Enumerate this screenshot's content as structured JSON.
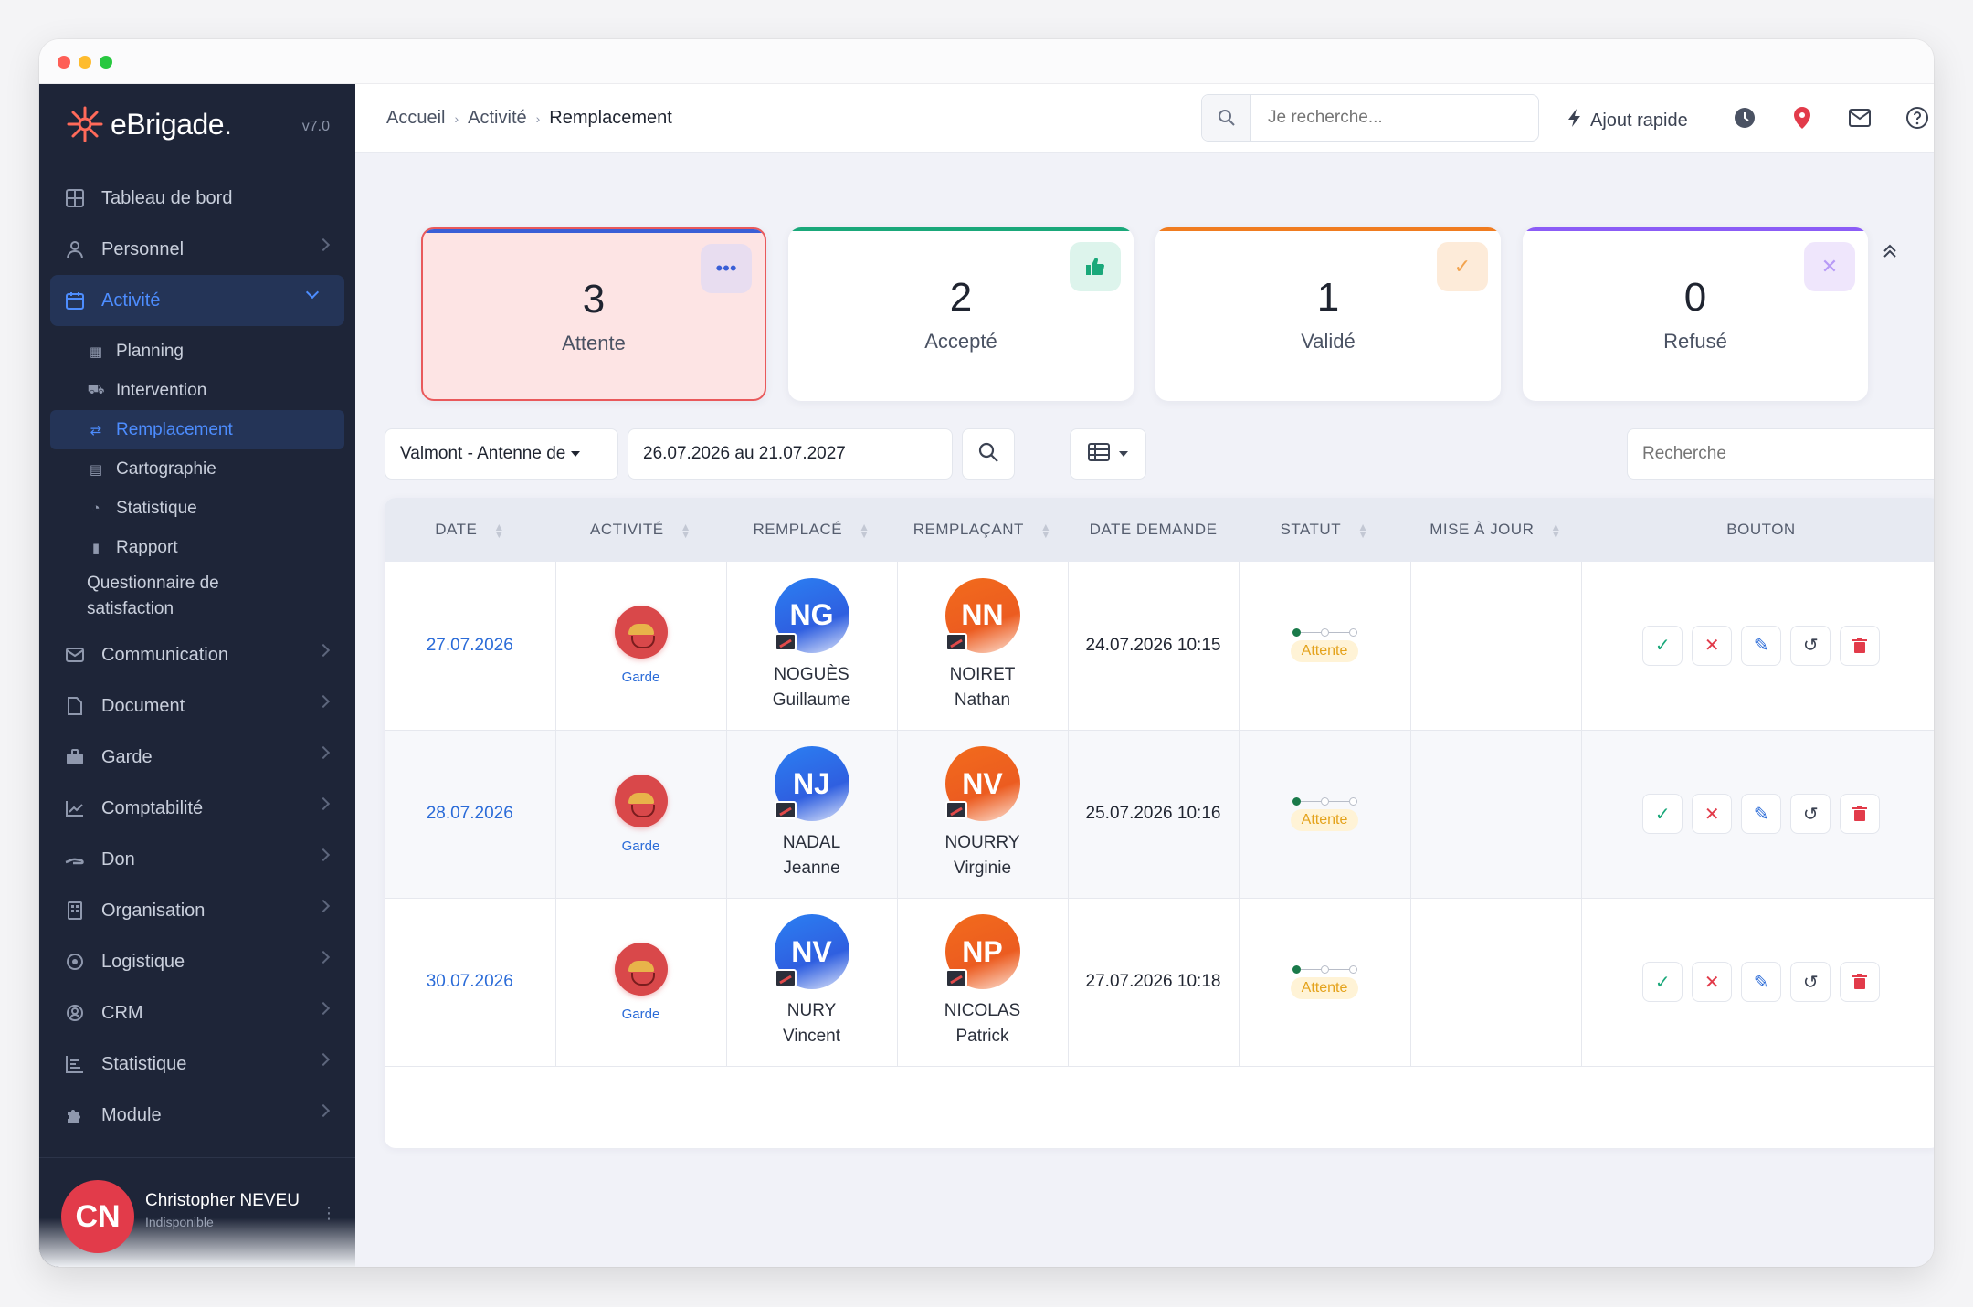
{
  "app": {
    "brand": "eBrigade.",
    "version": "v7.0"
  },
  "sidebar": {
    "items": [
      {
        "label": "Tableau de bord",
        "icon": "dashboard-icon"
      },
      {
        "label": "Personnel",
        "icon": "user-icon"
      },
      {
        "label": "Activité",
        "icon": "calendar-icon"
      },
      {
        "label": "Communication",
        "icon": "mail-icon"
      },
      {
        "label": "Document",
        "icon": "file-icon"
      },
      {
        "label": "Garde",
        "icon": "briefcase-icon"
      },
      {
        "label": "Comptabilité",
        "icon": "chart-icon"
      },
      {
        "label": "Don",
        "icon": "hand-icon"
      },
      {
        "label": "Organisation",
        "icon": "building-icon"
      },
      {
        "label": "Logistique",
        "icon": "target-icon"
      },
      {
        "label": "CRM",
        "icon": "user-circle-icon"
      },
      {
        "label": "Statistique",
        "icon": "stats-icon"
      },
      {
        "label": "Module",
        "icon": "puzzle-icon"
      }
    ],
    "sub_items": [
      {
        "label": "Planning",
        "icon": "calendar-small-icon"
      },
      {
        "label": "Intervention",
        "icon": "truck-icon"
      },
      {
        "label": "Remplacement",
        "icon": "swap-icon"
      },
      {
        "label": "Cartographie",
        "icon": "map-icon"
      },
      {
        "label": "Statistique",
        "icon": "pie-icon"
      },
      {
        "label": "Rapport",
        "icon": "report-icon"
      },
      {
        "label": "Questionnaire de satisfaction",
        "icon": ""
      }
    ],
    "user": {
      "initials": "CN",
      "name": "Christopher NEVEU",
      "status": "Indisponible"
    }
  },
  "topbar": {
    "breadcrumb": [
      "Accueil",
      "Activité",
      "Remplacement"
    ],
    "search_placeholder": "Je recherche...",
    "quick_add": "Ajout rapide"
  },
  "cards": [
    {
      "count": "3",
      "label": "Attente"
    },
    {
      "count": "2",
      "label": "Accepté"
    },
    {
      "count": "1",
      "label": "Validé"
    },
    {
      "count": "0",
      "label": "Refusé"
    }
  ],
  "filters": {
    "section": "Valmont - Antenne de",
    "date_range": "26.07.2026 au 21.07.2027",
    "search_placeholder": "Recherche"
  },
  "table": {
    "headers": [
      "DATE",
      "ACTIVITÉ",
      "REMPLACÉ",
      "REMPLAÇANT",
      "DATE DEMANDE",
      "STATUT",
      "MISE À JOUR",
      "BOUTON"
    ],
    "rows": [
      {
        "date": "27.07.2026",
        "activity": "Garde",
        "replaced": {
          "initials": "NG",
          "last": "NOGUÈS",
          "first": "Guillaume"
        },
        "replacement": {
          "initials": "NN",
          "last": "NOIRET",
          "first": "Nathan"
        },
        "requested": "24.07.2026 10:15",
        "status": "Attente"
      },
      {
        "date": "28.07.2026",
        "activity": "Garde",
        "replaced": {
          "initials": "NJ",
          "last": "NADAL",
          "first": "Jeanne"
        },
        "replacement": {
          "initials": "NV",
          "last": "NOURRY",
          "first": "Virginie"
        },
        "requested": "25.07.2026 10:16",
        "status": "Attente"
      },
      {
        "date": "30.07.2026",
        "activity": "Garde",
        "replaced": {
          "initials": "NV",
          "last": "NURY",
          "first": "Vincent"
        },
        "replacement": {
          "initials": "NP",
          "last": "NICOLAS",
          "first": "Patrick"
        },
        "requested": "27.07.2026 10:18",
        "status": "Attente"
      }
    ]
  },
  "colors": {
    "sidebar_bg": "#1e2538",
    "accent": "#4d8dff",
    "pending_bg": "#fde4e4",
    "accepted": "#1aa87a",
    "validated": "#f07c20",
    "refused": "#8b5cf6"
  }
}
